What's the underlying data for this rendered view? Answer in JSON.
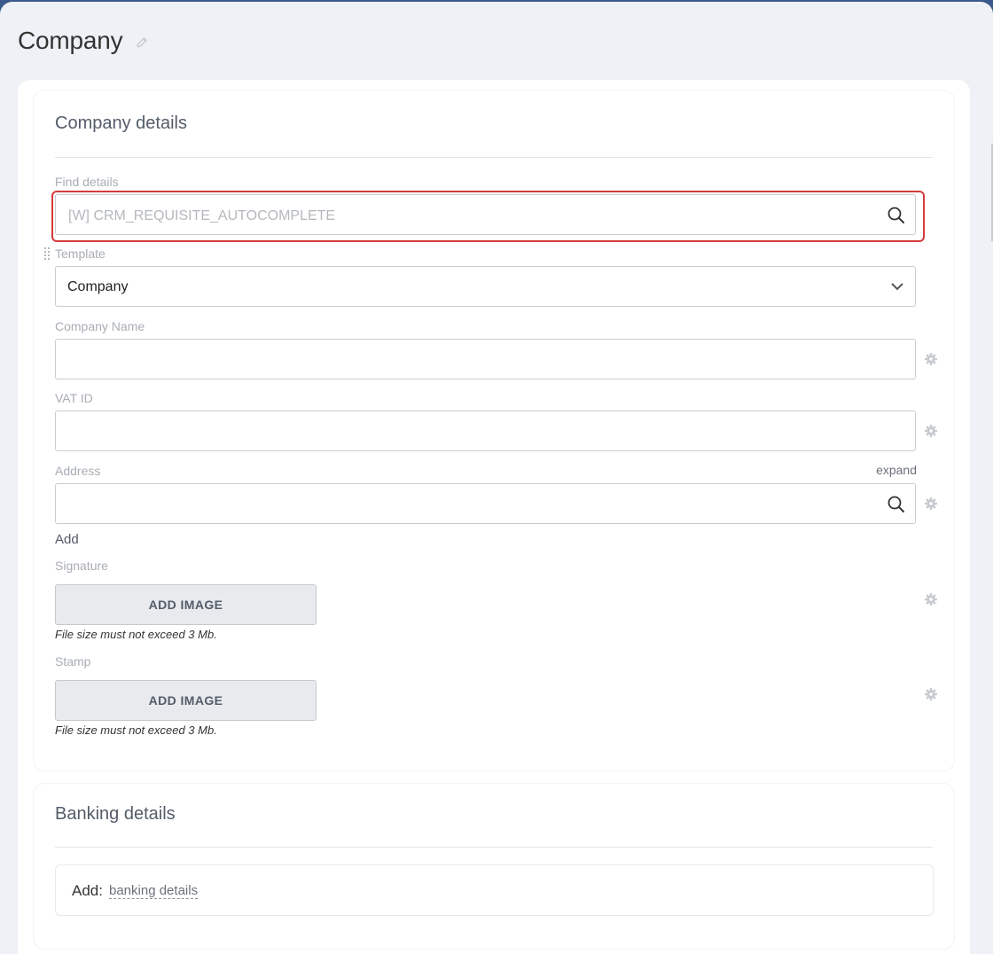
{
  "page": {
    "title": "Company"
  },
  "company_details": {
    "title": "Company details",
    "find_details": {
      "label": "Find details",
      "placeholder": "[W] CRM_REQUISITE_AUTOCOMPLETE"
    },
    "template": {
      "label": "Template",
      "value": "Company"
    },
    "company_name": {
      "label": "Company Name",
      "value": ""
    },
    "vat_id": {
      "label": "VAT ID",
      "value": ""
    },
    "address": {
      "label": "Address",
      "expand_label": "expand",
      "value": "",
      "add_label": "Add"
    },
    "signature": {
      "label": "Signature",
      "button_label": "ADD IMAGE",
      "hint": "File size must not exceed 3 Mb."
    },
    "stamp": {
      "label": "Stamp",
      "button_label": "ADD IMAGE",
      "hint": "File size must not exceed 3 Mb."
    }
  },
  "banking_details": {
    "title": "Banking details",
    "add_prefix": "Add:",
    "add_link": "banking details"
  },
  "colors": {
    "highlight": "#d33b3b",
    "background": "#eef1f5",
    "text_muted": "#a8adb4"
  },
  "icons": [
    "pencil-icon",
    "search-icon",
    "chevron-down-icon",
    "gear-icon",
    "drag-handle-icon"
  ]
}
